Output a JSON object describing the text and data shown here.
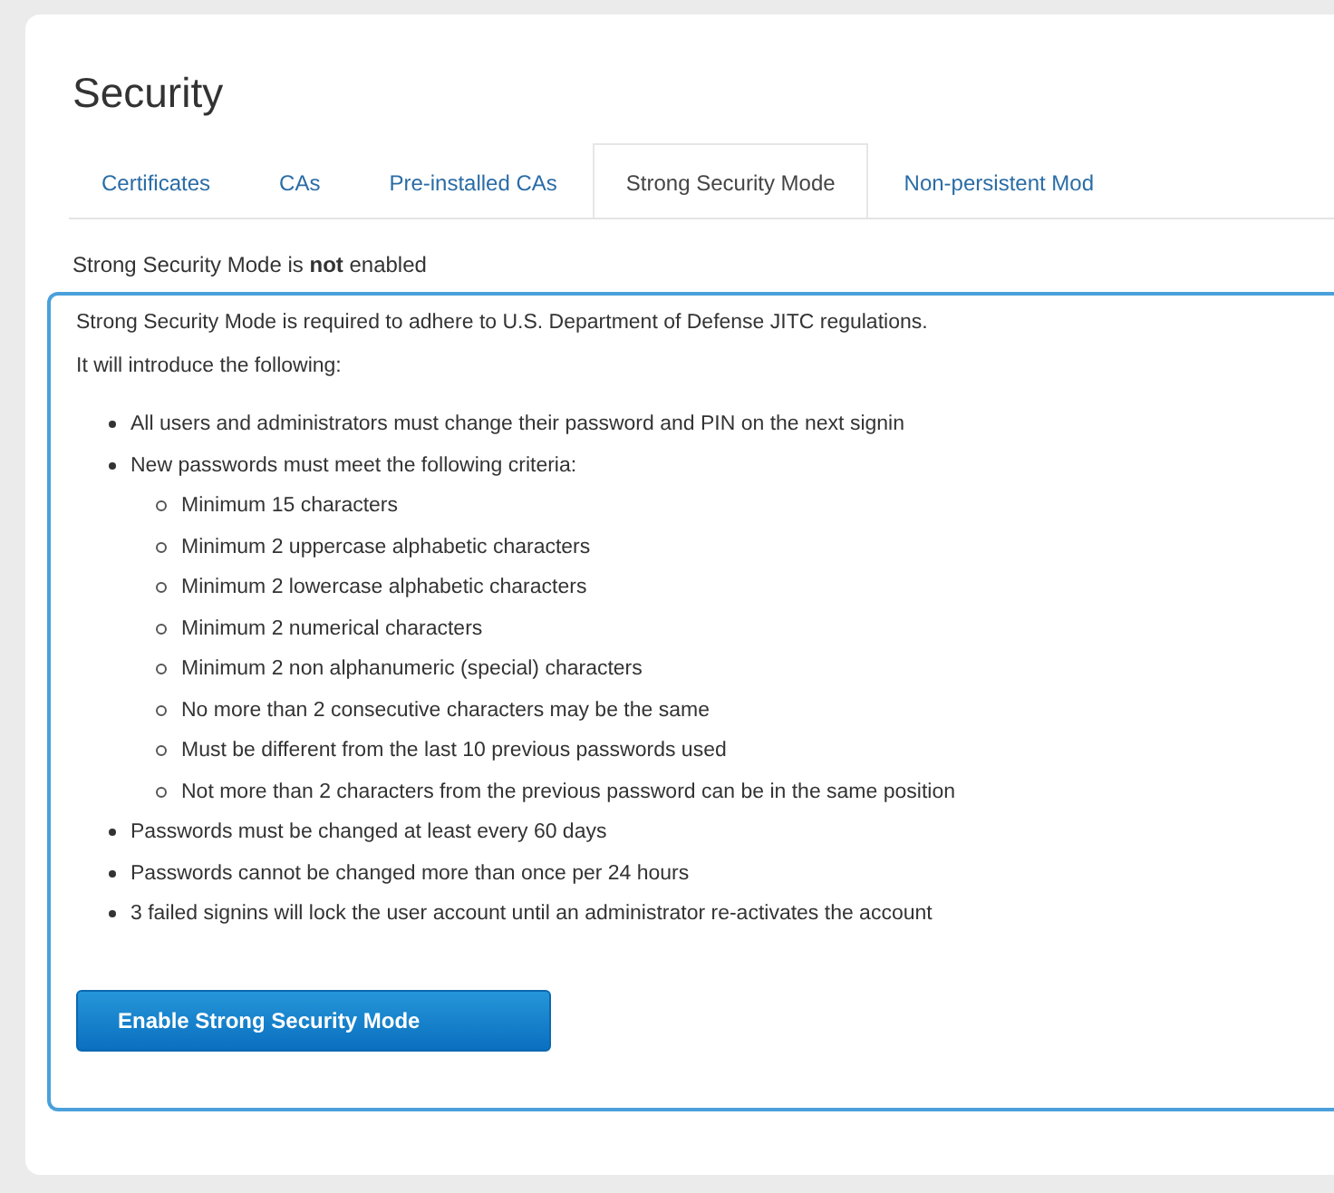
{
  "title": "Security",
  "tabs": [
    {
      "label": "Certificates",
      "selected": false
    },
    {
      "label": "CAs",
      "selected": false
    },
    {
      "label": "Pre-installed CAs",
      "selected": false
    },
    {
      "label": "Strong Security Mode",
      "selected": true
    },
    {
      "label": "Non-persistent Mod",
      "selected": false
    }
  ],
  "status": "Strong Security Mode is **not** enabled",
  "notice": {
    "intro": "Strong Security Mode is required to adhere to U.S. Department of Defense JITC regulations.",
    "lead": "It will introduce the following:",
    "items": [
      {
        "text": "All users and administrators must change their password and PIN on the next signin"
      },
      {
        "text": "New passwords must meet the following criteria:",
        "children": [
          {
            "text": "Minimum 15 characters"
          },
          {
            "text": "Minimum 2 uppercase alphabetic characters"
          },
          {
            "text": "Minimum 2 lowercase alphabetic characters"
          },
          {
            "text": "Minimum 2 numerical characters"
          },
          {
            "text": "Minimum 2 non alphanumeric (special) characters"
          },
          {
            "text": "No more than 2 consecutive characters may be the same"
          },
          {
            "text": "Must be different from the last 10 previous passwords used"
          },
          {
            "text": "Not more than 2 characters from the previous password can be in the same position"
          }
        ]
      },
      {
        "text": "Passwords must be changed at least every 60 days"
      },
      {
        "text": "Passwords cannot be changed more than once per 24 hours"
      },
      {
        "text": "3 failed signins will lock the user account until an administrator re-activates the account"
      }
    ]
  },
  "button": "Enable Strong Security Mode"
}
